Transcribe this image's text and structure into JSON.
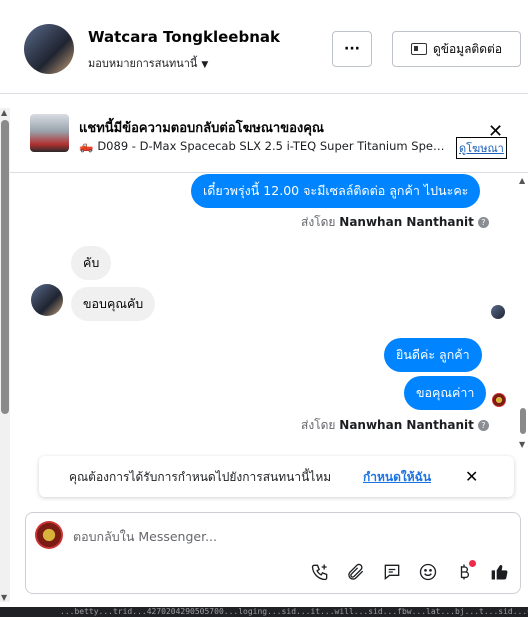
{
  "header": {
    "contact_name": "Watcara Tongkleebnak",
    "assignee_label": "มอบหมายการสนทนานี้",
    "more_label": "···",
    "contact_info_label": "ดูข้อมูลติดต่อ"
  },
  "ad_reply": {
    "title": "แชทนี้มีข้อความตอบกลับต่อโฆษณาของคุณ",
    "description": "D089 - D-Max Spacecab SLX 2.5 i-TEQ Super Titanium Speed ...",
    "view_ad_label": "ดูโฆษณา",
    "close_label": "✕"
  },
  "messages": {
    "m1": "เดี๋ยวพรุ่งนี้ 12.00 จะมีเซลล์ติดต่อ ลูกค้า ไปนะคะ",
    "sent_by_prefix_1": "ส่งโดย",
    "sent_by_name_1": "Nanwhan Nanthanit",
    "m2": "คับ",
    "m3": "ขอบคุณคับ",
    "m4": "ยินดีค่ะ  ลูกค้า",
    "m5": "ขอคุณค่าา",
    "sent_by_prefix_2": "ส่งโดย",
    "sent_by_name_2": "Nanwhan Nanthanit",
    "help_glyph": "?"
  },
  "notice": {
    "text": "คุณต้องการได้รับการกำหนดไปยังการสนทนานี้ไหม",
    "link": "กำหนดให้ฉัน",
    "close_label": "✕"
  },
  "composer": {
    "placeholder": "ตอบกลับใน Messenger..."
  },
  "bottom_bar_text": "...betty...trid...4270204290505700...loging...sid...it...will...sid...fbw...lat...bj...t...sid...6",
  "colors": {
    "outgoing_bubble": "#0084ff",
    "incoming_bubble": "#f0f0f0",
    "link": "#1b74e4",
    "like": "#050505"
  }
}
